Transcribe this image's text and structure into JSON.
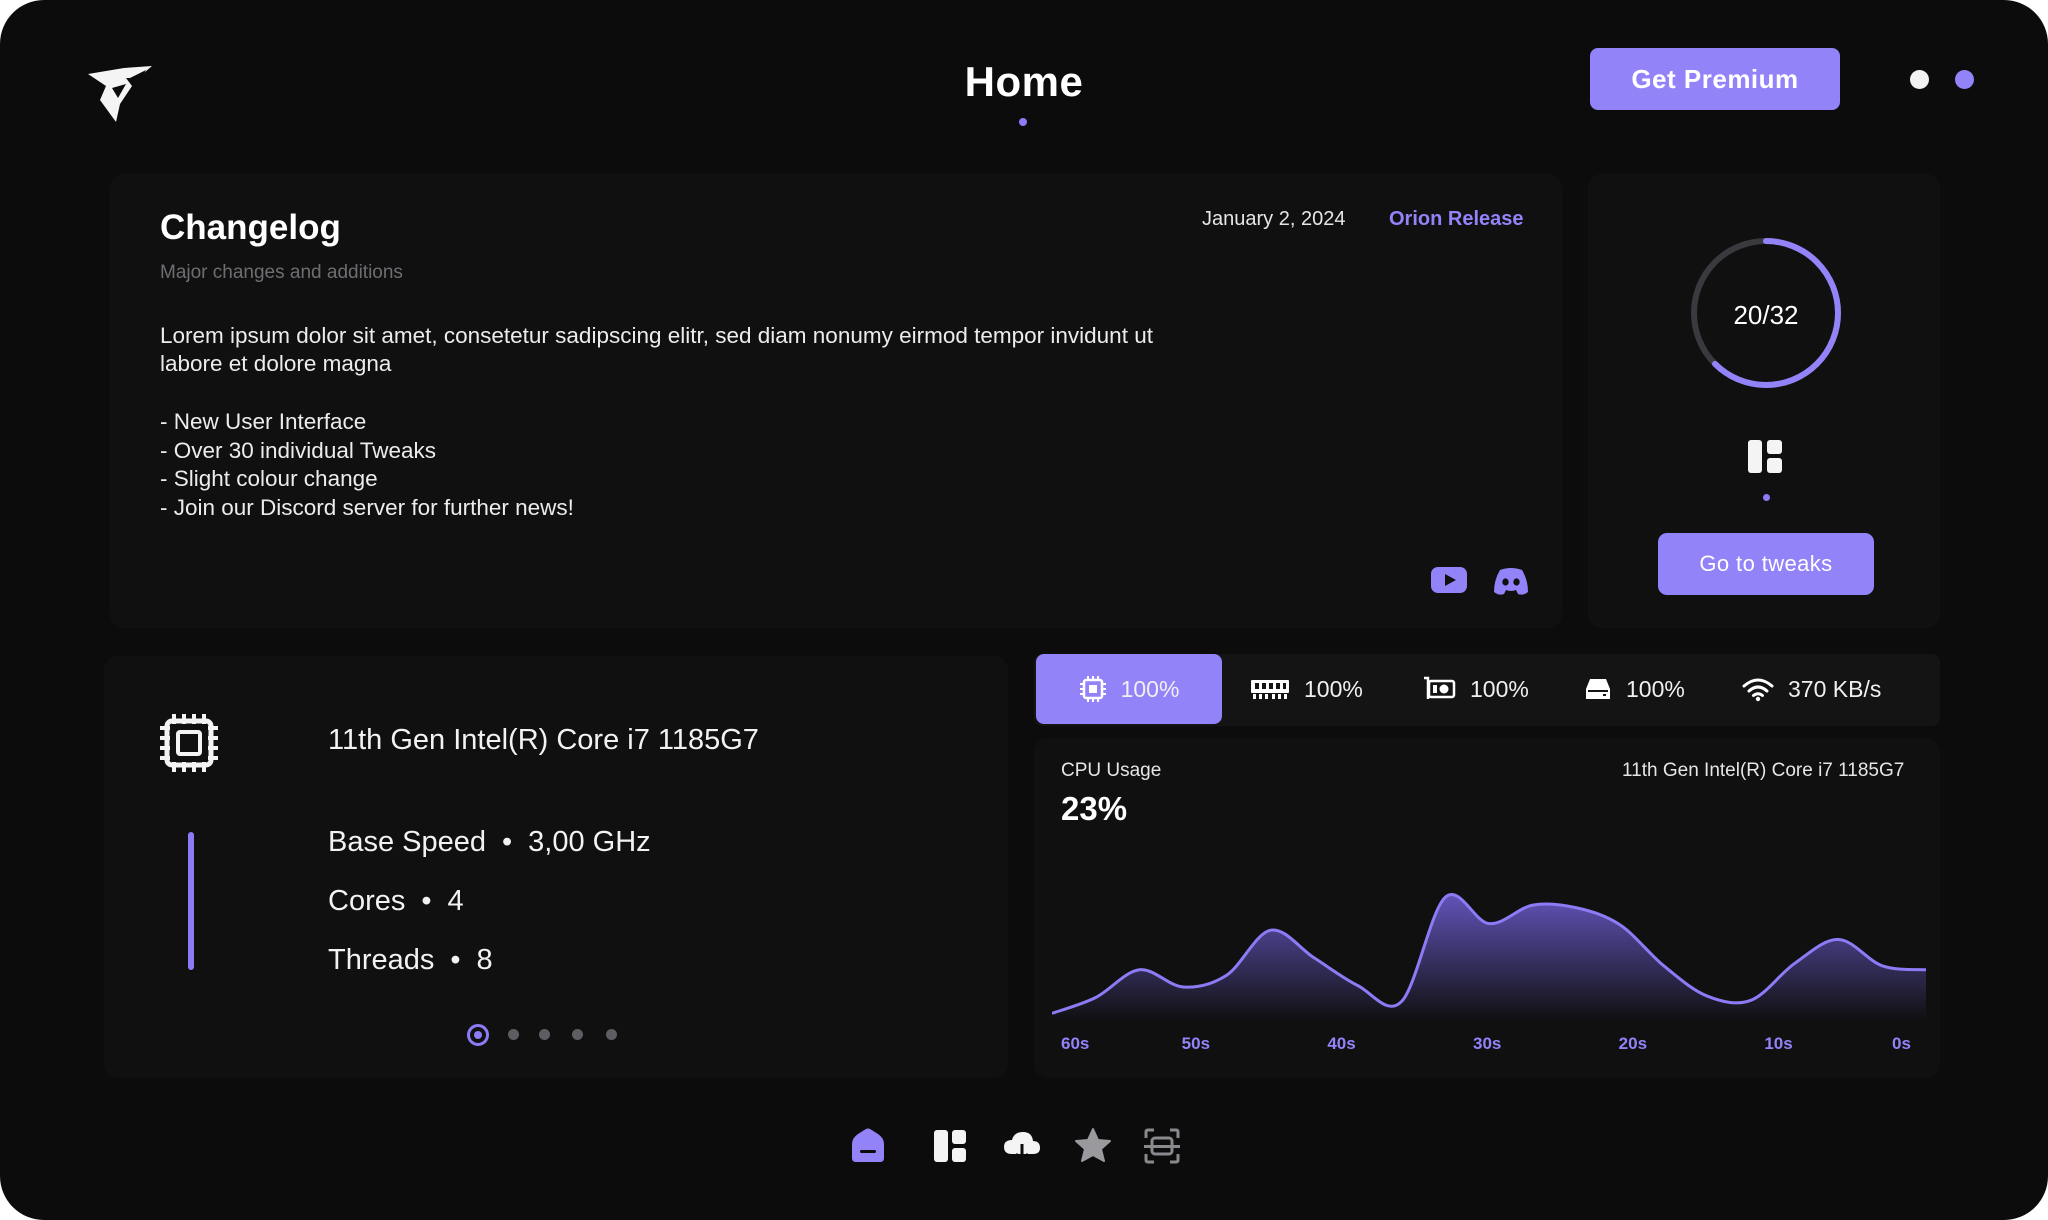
{
  "header": {
    "title": "Home",
    "premium_label": "Get Premium",
    "logo_icon": "brand-logo-icon"
  },
  "colors": {
    "accent": "#9283f9",
    "background": "#0c0c0d",
    "panel": "#101011",
    "muted_text": "#6e6e72"
  },
  "changelog": {
    "title": "Changelog",
    "subtitle": "Major changes and additions",
    "date": "January 2, 2024",
    "release": "Orion Release",
    "body": "Lorem ipsum dolor sit amet, consetetur sadipscing elitr, sed diam nonumy eirmod tempor invidunt ut labore et dolore magna",
    "items": [
      "- New User Interface",
      "- Over 30 individual Tweaks",
      "- Slight colour change",
      "- Join our Discord server for further news!"
    ],
    "social_icons": [
      "youtube-icon",
      "discord-icon"
    ]
  },
  "tweaks": {
    "applied": 20,
    "total": 32,
    "progress_label": "20/32",
    "button_label": "Go to tweaks"
  },
  "cpu": {
    "name": "11th Gen Intel(R) Core i7 1185G7",
    "specs": [
      {
        "label": "Base Speed",
        "value": "3,00 GHz"
      },
      {
        "label": "Cores",
        "value": "4"
      },
      {
        "label": "Threads",
        "value": "8"
      }
    ],
    "pager": {
      "count": 5,
      "active": 0
    }
  },
  "tabs": [
    {
      "icon": "cpu-icon",
      "value": "100%",
      "active": true
    },
    {
      "icon": "ram-icon",
      "value": "100%",
      "active": false
    },
    {
      "icon": "gpu-icon",
      "value": "100%",
      "active": false
    },
    {
      "icon": "disk-icon",
      "value": "100%",
      "active": false
    },
    {
      "icon": "wifi-icon",
      "value": "370 KB/s",
      "active": false
    }
  ],
  "chart": {
    "label": "CPU Usage",
    "value": "23%",
    "device": "11th Gen Intel(R) Core i7 1185G7"
  },
  "chart_data": {
    "type": "area",
    "xlabel": "",
    "ylabel": "",
    "x_ticks": [
      "60s",
      "50s",
      "40s",
      "30s",
      "20s",
      "10s",
      "0s"
    ],
    "x": [
      60,
      57,
      54,
      51,
      48,
      45,
      42,
      39,
      36,
      33,
      30,
      27,
      24,
      21,
      18,
      15,
      12,
      9,
      6,
      3,
      0
    ],
    "ylim": [
      0,
      100
    ],
    "series": [
      {
        "values": [
          2,
          14,
          35,
          22,
          31,
          65,
          44,
          23,
          11,
          90,
          70,
          84,
          82,
          69,
          38,
          15,
          12,
          40,
          58,
          38,
          35
        ]
      }
    ]
  },
  "bottom_nav": [
    {
      "icon": "home-icon",
      "active": true
    },
    {
      "icon": "tweaks-grid-icon",
      "active": false
    },
    {
      "icon": "cloud-download-icon",
      "active": false
    },
    {
      "icon": "star-icon",
      "active": false
    },
    {
      "icon": "scan-icon",
      "active": false
    }
  ]
}
